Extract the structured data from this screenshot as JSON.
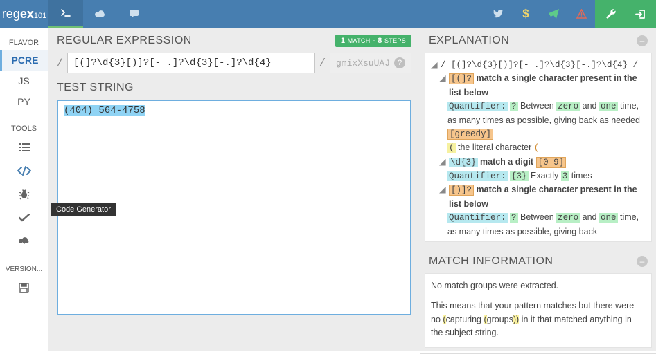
{
  "logo": {
    "part1": "reg",
    "part2": "ex",
    "part3": "101"
  },
  "header_icons": [
    "twitter",
    "dollar",
    "plane",
    "warning"
  ],
  "sidebar": {
    "flavor_label": "FLAVOR",
    "flavors": [
      "PCRE",
      "JS",
      "PY"
    ],
    "tools_label": "TOOLS",
    "version_label": "VERSION..."
  },
  "tooltip": "Code Generator",
  "regex": {
    "title": "REGULAR EXPRESSION",
    "pattern": "[(]?\\d{3}[)]?[- .]?\\d{3}[-.]?\\d{4}",
    "flags_placeholder": "gmixXsuUAJ",
    "badge_match_count": "1",
    "badge_match_word": "MATCH",
    "badge_sep": " - ",
    "badge_steps_count": "8",
    "badge_steps_word": "STEPS"
  },
  "teststring": {
    "title": "TEST STRING",
    "value": "(404) 564-4758"
  },
  "explanation": {
    "title": "EXPLANATION",
    "pattern_display": "/ [(]?\\d{3}[)]?[- .]?\\d{3}[-.]?\\d{4} /",
    "rows": [
      {
        "tok": "[(]?",
        "text": "match a single character present in the list below"
      },
      {
        "q_label": "Quantifier:",
        "q_sym": "?",
        "q_between": "Between",
        "q_a": "zero",
        "q_and": "and",
        "q_b": "one",
        "q_tail": "time, as many times as possible, giving back as needed",
        "q_greedy": "[greedy]"
      },
      {
        "char": "(",
        "char_text": "the literal character",
        "char_val": "("
      },
      {
        "tok": "\\d{3}",
        "d_text": "match a digit",
        "d_range": "[0-9]"
      },
      {
        "q_label": "Quantifier:",
        "q_sym": "{3}",
        "q_exact": "Exactly",
        "q_n": "3",
        "q_times": "times"
      },
      {
        "tok": "[)]?",
        "text": "match a single character present in the list below"
      },
      {
        "q_label": "Quantifier:",
        "q_sym": "?",
        "q_between": "Between",
        "q_a": "zero",
        "q_and": "and",
        "q_b": "one",
        "q_tail": "time, as many times as possible, giving back"
      }
    ]
  },
  "matchinfo": {
    "title": "MATCH INFORMATION",
    "line1": "No match groups were extracted.",
    "line2a": "This means that your pattern matches but there were no ",
    "paren1": "(",
    "line2b": "capturing ",
    "paren2": "(",
    "line2c": "groups",
    "paren3": "))",
    "line2d": " in it that matched anything in the subject string."
  }
}
